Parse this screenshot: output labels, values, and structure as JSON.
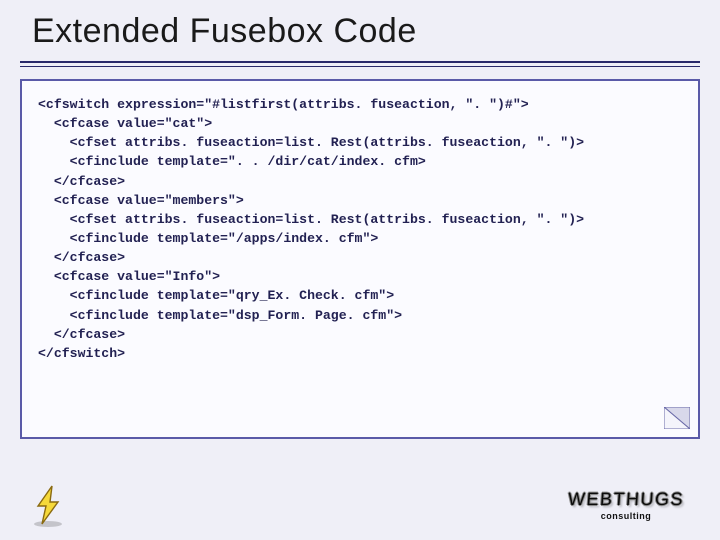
{
  "title": "Extended Fusebox Code",
  "code": {
    "lines": [
      "<cfswitch expression=\"#listfirst(attribs. fuseaction, \". \")#\">",
      "  <cfcase value=\"cat\">",
      "    <cfset attribs. fuseaction=list. Rest(attribs. fuseaction, \". \")>",
      "    <cfinclude template=\". . /dir/cat/index. cfm>",
      "  </cfcase>",
      "  <cfcase value=\"members\">",
      "    <cfset attribs. fuseaction=list. Rest(attribs. fuseaction, \". \")>",
      "    <cfinclude template=\"/apps/index. cfm\">",
      "  </cfcase>",
      "  <cfcase value=\"Info\">",
      "    <cfinclude template=\"qry_Ex. Check. cfm\">",
      "    <cfinclude template=\"dsp_Form. Page. cfm\">",
      "  </cfcase>",
      "</cfswitch>"
    ]
  },
  "logo": {
    "bolt_alt": "lightning-bolt",
    "brand": "WEBTHUGS",
    "brand_sub": "consulting"
  }
}
